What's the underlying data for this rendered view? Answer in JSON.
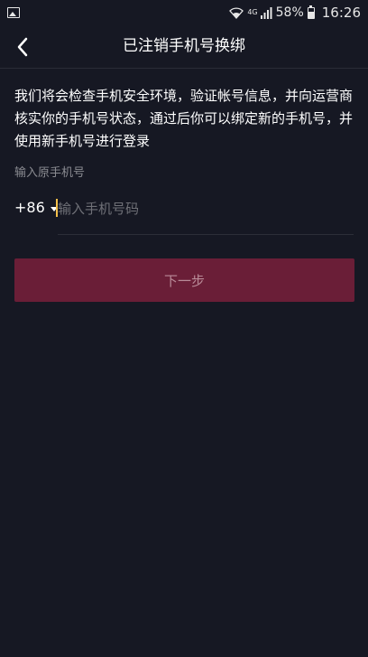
{
  "status_bar": {
    "signal_label": "4G",
    "battery_percent": "58%",
    "time": "16:26"
  },
  "header": {
    "title": "已注销手机号换绑"
  },
  "main": {
    "description": "我们将会检查手机安全环境，验证帐号信息，并向运营商核实你的手机号状态，通过后你可以绑定新的手机号，并使用新手机号进行登录",
    "field_label": "输入原手机号",
    "country_code": "+86",
    "phone_placeholder": "输入手机号码",
    "phone_value": "",
    "next_label": "下一步"
  },
  "colors": {
    "background": "#161823",
    "button_disabled": "#6a1e37",
    "cursor": "#f5c04a"
  },
  "icons": [
    "gallery-icon",
    "wifi-icon",
    "signal-icon",
    "battery-icon",
    "back-icon",
    "caret-down-icon"
  ]
}
